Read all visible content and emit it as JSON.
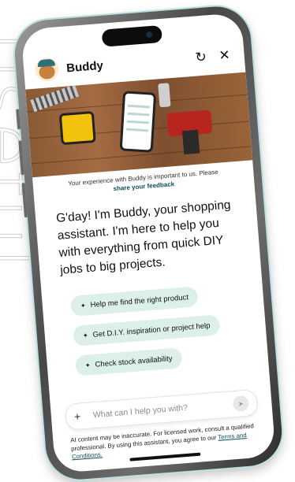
{
  "background_text": "useful",
  "header": {
    "title": "Buddy",
    "refresh_icon": "refresh-icon",
    "close_icon": "close-icon"
  },
  "hero": {
    "image": "tools-on-wooden-table"
  },
  "feedback": {
    "text": "Your experience with Buddy is important to us. Please",
    "link": "share your feedback"
  },
  "greeting": "G'day! I'm Buddy, your shopping assistant. I'm here to help you with everything from quick DIY jobs to big projects.",
  "suggestions": [
    {
      "icon": "sparkle-icon",
      "label": "Help me find the right product"
    },
    {
      "icon": "sparkle-icon",
      "label": "Get D.I.Y. inspiration or project help"
    },
    {
      "icon": "sparkle-icon",
      "label": "Check stock availability"
    }
  ],
  "input": {
    "placeholder": "What can I help you with?",
    "value": ""
  },
  "disclaimer": {
    "text": "AI content may be inaccurate. For licensed work, consult a qualified professional. By using this assistant, you agree to our",
    "link": "Terms and Conditions."
  },
  "colors": {
    "accent": "#0e4f58",
    "chip_bg": "#dcefe9",
    "phone_glow": "#b9e3e2"
  }
}
